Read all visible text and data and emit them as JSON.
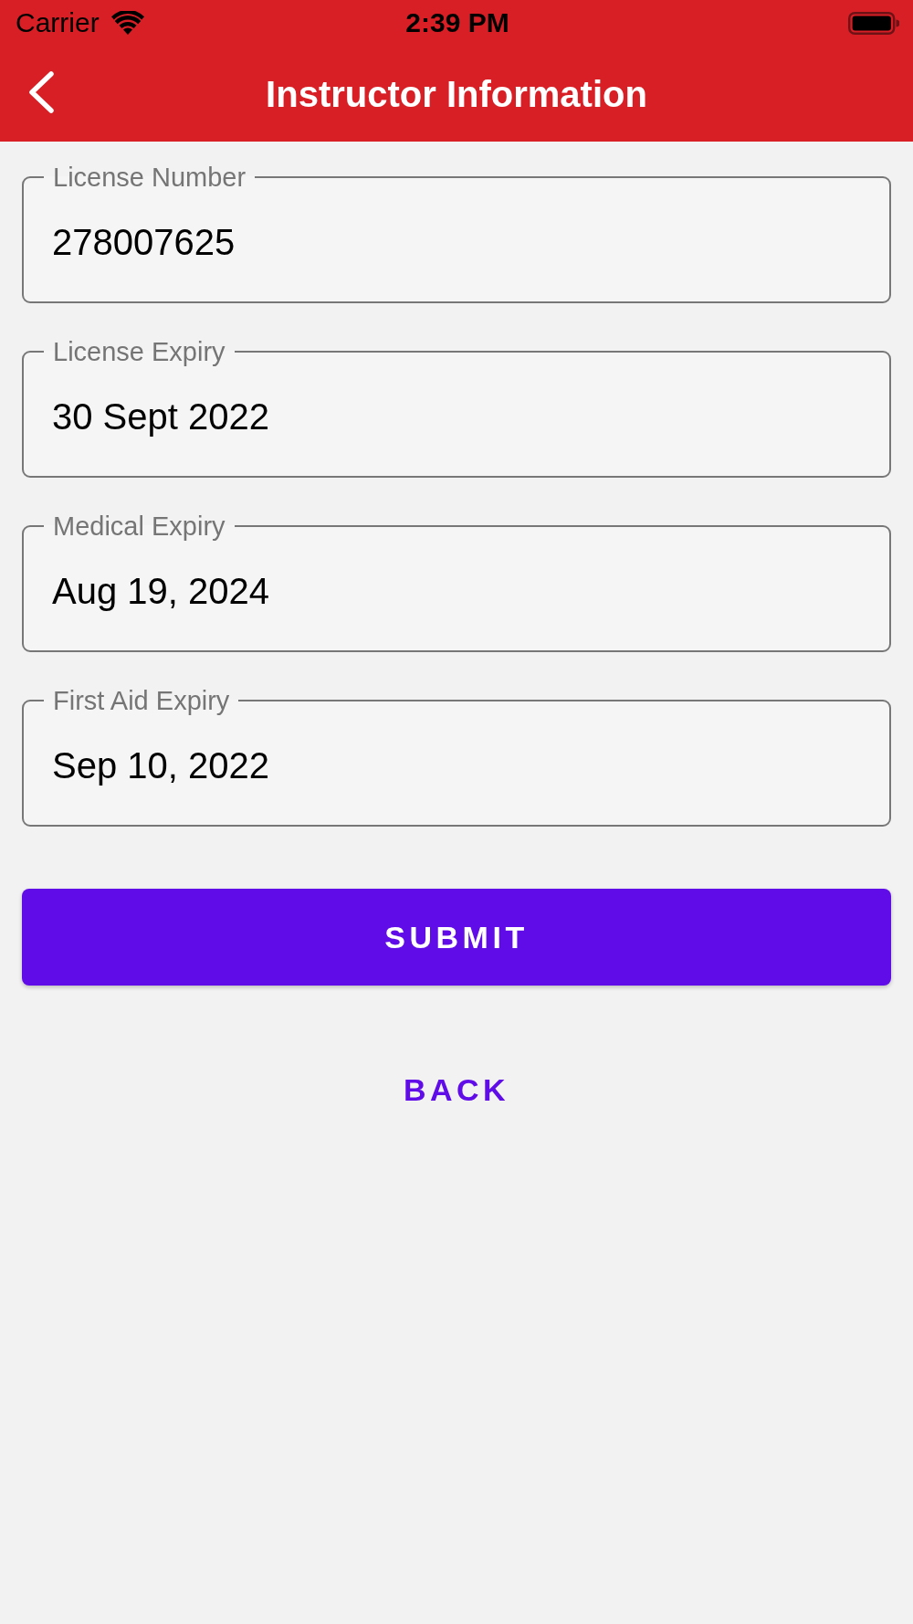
{
  "status_bar": {
    "carrier": "Carrier",
    "time": "2:39 PM"
  },
  "header": {
    "title": "Instructor Information"
  },
  "fields": [
    {
      "label": "License Number",
      "value": "278007625"
    },
    {
      "label": "License Expiry",
      "value": "30 Sept 2022"
    },
    {
      "label": "Medical Expiry",
      "value": "Aug 19, 2024"
    },
    {
      "label": "First Aid Expiry",
      "value": "Sep 10, 2022"
    }
  ],
  "buttons": [
    {
      "label": "SUBMIT",
      "kind": "filled"
    },
    {
      "label": "BACK",
      "kind": "text"
    }
  ]
}
